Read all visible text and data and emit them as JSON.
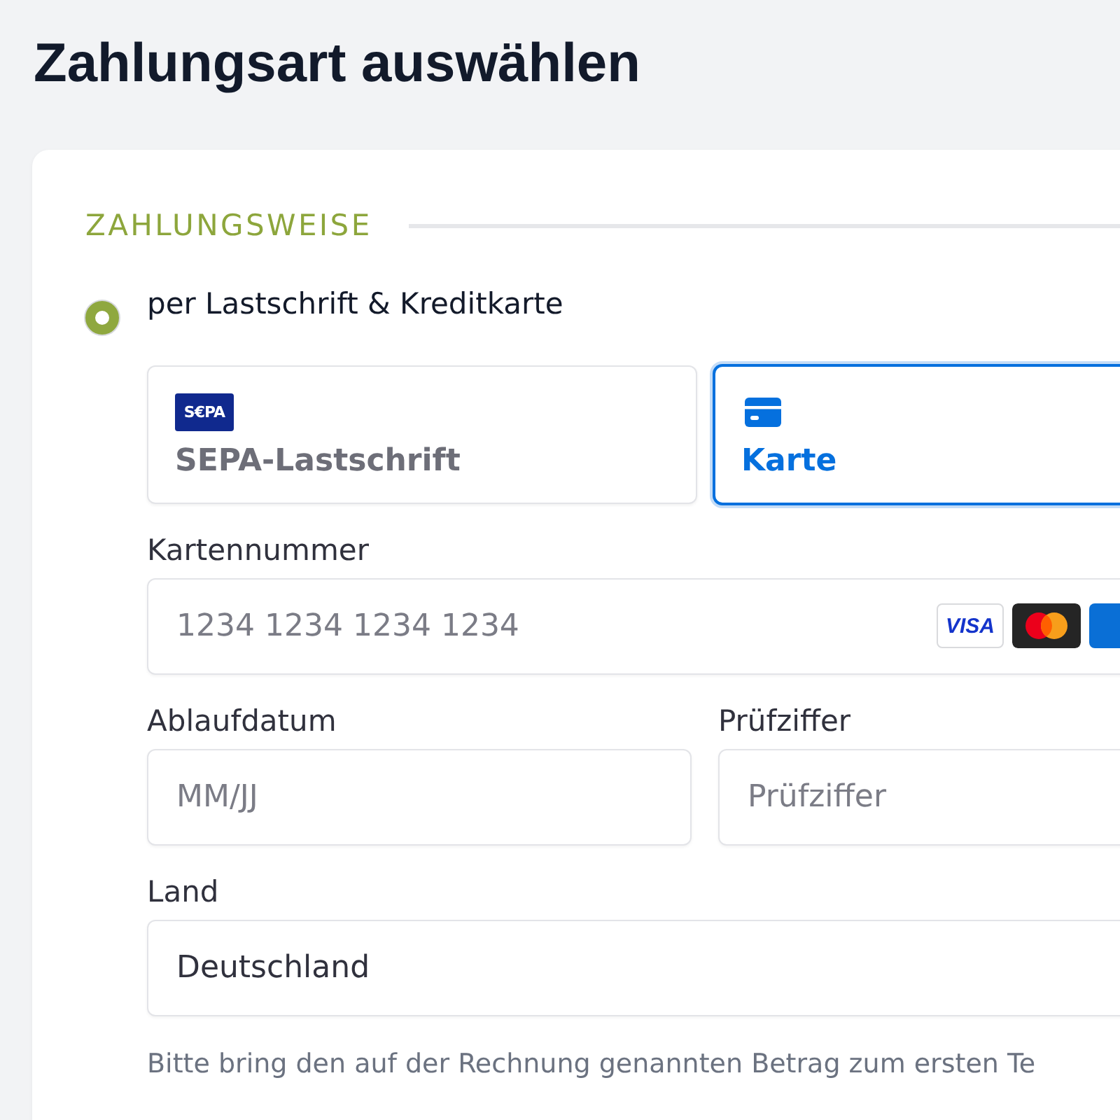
{
  "page": {
    "title": "Zahlungsart auswählen"
  },
  "section": {
    "heading": "ZAHLUNGSWEISE"
  },
  "payment_option": {
    "label": "per Lastschrift & Kreditkarte",
    "selected": true
  },
  "method_tabs": [
    {
      "kind": "sepa",
      "logo": "S€PA",
      "label": "SEPA-Lastschrift",
      "selected": false
    },
    {
      "kind": "card",
      "label": "Karte",
      "selected": true
    }
  ],
  "card_number": {
    "label": "Kartennummer",
    "placeholder": "1234 1234 1234 1234",
    "brands": [
      {
        "kind": "wordmark",
        "text": "VISA"
      },
      {
        "kind": "circles"
      },
      {
        "kind": "tile"
      }
    ]
  },
  "expiry": {
    "label": "Ablaufdatum",
    "placeholder": "MM/JJ"
  },
  "cvc": {
    "label": "Prüfziffer",
    "placeholder": "Prüfziffer"
  },
  "country": {
    "label": "Land",
    "value": "Deutschland"
  },
  "note": "Bitte bring den auf der Rechnung genannten Betrag zum ersten Te"
}
